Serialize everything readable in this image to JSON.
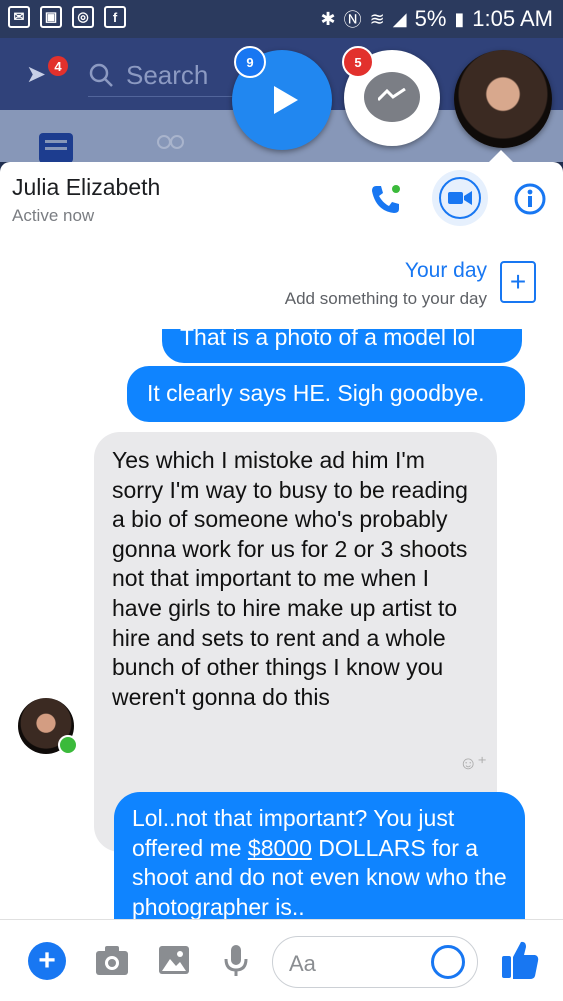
{
  "status_bar": {
    "battery": "5%",
    "time": "1:05 AM",
    "left_icons": [
      "mail-icon",
      "gallery-icon",
      "instagram-icon",
      "facebook-icon"
    ],
    "right_icons": [
      "bluetooth-icon",
      "nfc-icon",
      "wifi-icon",
      "signal-icon",
      "battery-icon"
    ]
  },
  "fb_header": {
    "search_placeholder": "Search",
    "notification_badge": "4"
  },
  "chat_heads": {
    "video_badge": "9",
    "messenger_badge": "5"
  },
  "chat_header": {
    "name": "Julia Elizabeth",
    "status": "Active now"
  },
  "your_day": {
    "title": "Your day",
    "subtitle": "Add something to your day"
  },
  "messages": [
    {
      "sender": "me",
      "text": "That is a photo of a model lol"
    },
    {
      "sender": "me",
      "text": "It clearly says HE. Sigh goodbye."
    },
    {
      "sender": "them",
      "text": "Yes which I mistoke ad him I'm sorry I'm way to busy to be reading a  bio of someone who's probably gonna work for us for 2 or 3 shoots not that important to me when I have girls to hire make up artist to hire and sets to rent and a whole bunch of other things I know you weren't gonna do this"
    },
    {
      "sender": "me",
      "text_before": "Lol..not that important? You just offered me ",
      "link": "$8000",
      "text_after": " DOLLARS for a shoot and do not even know who the photographer is.."
    }
  ],
  "composer": {
    "placeholder": "Aa"
  },
  "colors": {
    "accent": "#1877f2",
    "outgoing_bubble": "#0f84ff",
    "incoming_bubble": "#e9e9eb",
    "badge": "#e2312d"
  }
}
